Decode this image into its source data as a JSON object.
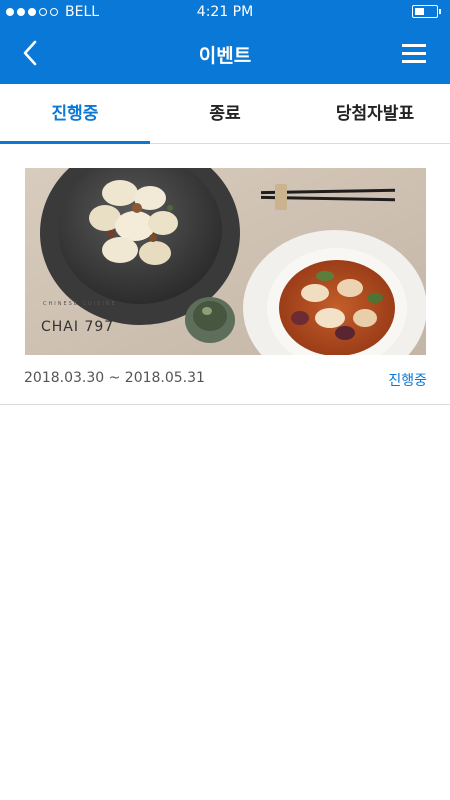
{
  "status_bar": {
    "carrier": "BELL",
    "time": "4:21 PM",
    "signal_bars": 3,
    "signal_total": 5,
    "battery_level": 0.45
  },
  "header": {
    "title": "이벤트",
    "back_icon": "chevron-left-icon",
    "menu_icon": "hamburger-menu-icon",
    "background_color": "#0a78d7"
  },
  "tabs": [
    {
      "label": "진행중",
      "active": true
    },
    {
      "label": "종료",
      "active": false
    },
    {
      "label": "당첨자발표",
      "active": false
    }
  ],
  "events": [
    {
      "banner": {
        "brand_subtitle": "CHINESE CUISINE",
        "brand_name": "CHAI 797"
      },
      "period": "2018.03.30 ~ 2018.05.31",
      "status": "진행중"
    }
  ],
  "accent_color": "#0a78d7"
}
